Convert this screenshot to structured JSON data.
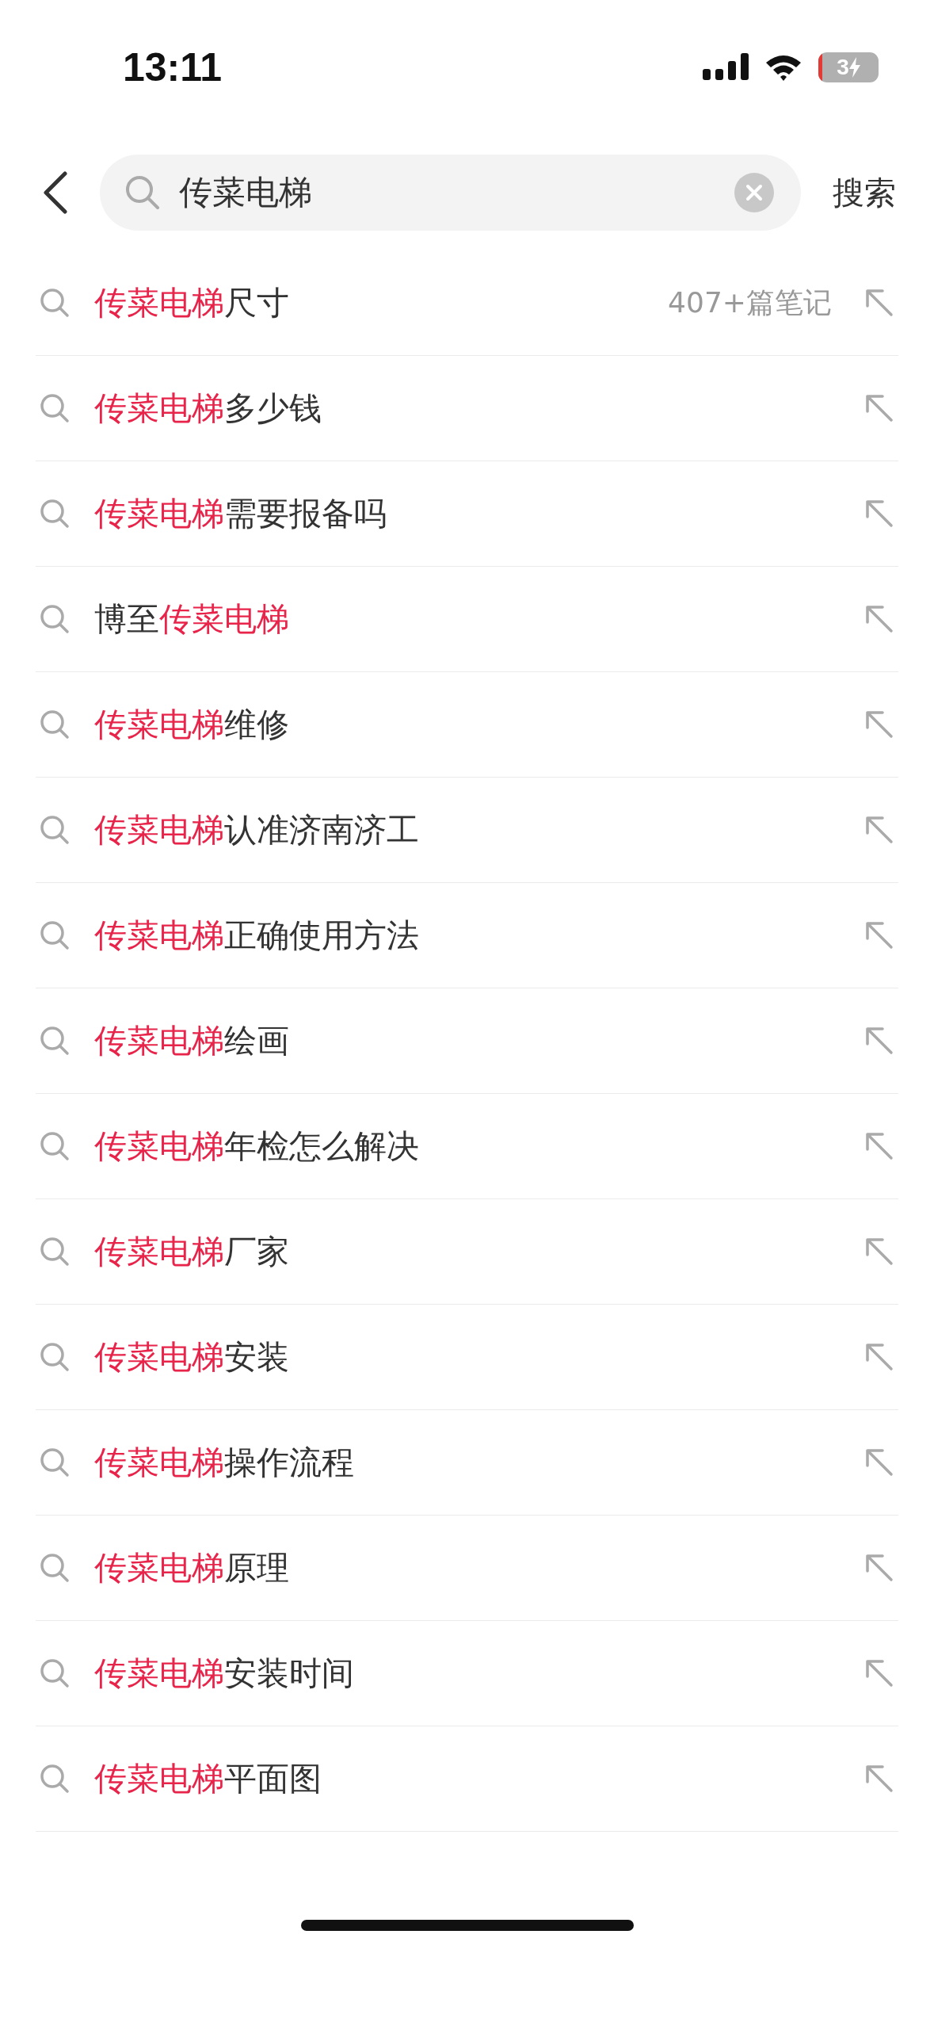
{
  "status_bar": {
    "time": "13:11",
    "battery": "3"
  },
  "search": {
    "value": "传菜电梯",
    "action": "搜索"
  },
  "suggestions": [
    {
      "parts": [
        {
          "text": "传菜电梯",
          "highlight": true
        },
        {
          "text": "尺寸",
          "highlight": false
        }
      ],
      "count": "407+篇笔记"
    },
    {
      "parts": [
        {
          "text": "传菜电梯",
          "highlight": true
        },
        {
          "text": "多少钱",
          "highlight": false
        }
      ]
    },
    {
      "parts": [
        {
          "text": "传菜电梯",
          "highlight": true
        },
        {
          "text": "需要报备吗",
          "highlight": false
        }
      ]
    },
    {
      "parts": [
        {
          "text": "博至",
          "highlight": false
        },
        {
          "text": "传菜电梯",
          "highlight": true
        }
      ]
    },
    {
      "parts": [
        {
          "text": "传菜电梯",
          "highlight": true
        },
        {
          "text": "维修",
          "highlight": false
        }
      ]
    },
    {
      "parts": [
        {
          "text": "传菜电梯",
          "highlight": true
        },
        {
          "text": "认准济南济工",
          "highlight": false
        }
      ]
    },
    {
      "parts": [
        {
          "text": "传菜电梯",
          "highlight": true
        },
        {
          "text": "正确使用方法",
          "highlight": false
        }
      ]
    },
    {
      "parts": [
        {
          "text": "传菜电梯",
          "highlight": true
        },
        {
          "text": "绘画",
          "highlight": false
        }
      ]
    },
    {
      "parts": [
        {
          "text": "传菜电梯",
          "highlight": true
        },
        {
          "text": "年检怎么解决",
          "highlight": false
        }
      ]
    },
    {
      "parts": [
        {
          "text": "传菜电梯",
          "highlight": true
        },
        {
          "text": "厂家",
          "highlight": false
        }
      ]
    },
    {
      "parts": [
        {
          "text": "传菜电梯",
          "highlight": true
        },
        {
          "text": "安装",
          "highlight": false
        }
      ]
    },
    {
      "parts": [
        {
          "text": "传菜电梯",
          "highlight": true
        },
        {
          "text": "操作流程",
          "highlight": false
        }
      ]
    },
    {
      "parts": [
        {
          "text": "传菜电梯",
          "highlight": true
        },
        {
          "text": "原理",
          "highlight": false
        }
      ]
    },
    {
      "parts": [
        {
          "text": "传菜电梯",
          "highlight": true
        },
        {
          "text": "安装时间",
          "highlight": false
        }
      ]
    },
    {
      "parts": [
        {
          "text": "传菜电梯",
          "highlight": true
        },
        {
          "text": "平面图",
          "highlight": false
        }
      ]
    }
  ]
}
